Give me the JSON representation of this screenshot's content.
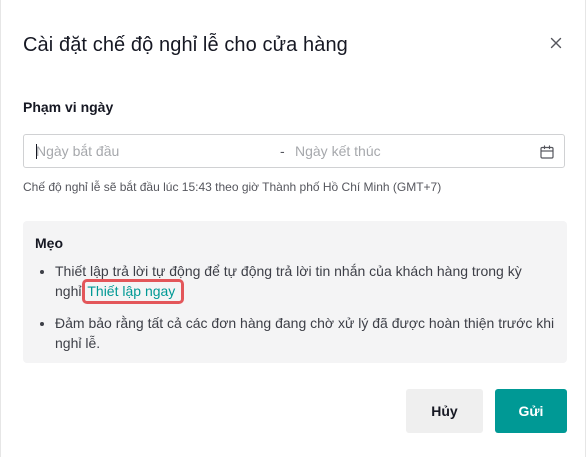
{
  "dialog": {
    "title": "Cài đặt chế độ nghỉ lễ cho cửa hàng",
    "close_icon": "close-icon"
  },
  "date_range": {
    "label": "Phạm vi ngày",
    "start_placeholder": "Ngày bắt đầu",
    "separator": "-",
    "end_placeholder": "Ngày kết thúc",
    "calendar_icon": "calendar-icon",
    "hint": "Chế độ nghỉ lễ sẽ bắt đầu lúc 15:43 theo giờ Thành phố Hồ Chí Minh (GMT+7)"
  },
  "tips": {
    "title": "Mẹo",
    "item1_text": "Thiết lập trả lời tự động để tự động trả lời tin nhắn của khách hàng trong kỳ nghỉ.",
    "item1_link": "Thiết lập ngay",
    "item2_text": "Đảm bảo rằng tất cả các đơn hàng đang chờ xử lý đã được hoàn thiện trước khi nghỉ lễ."
  },
  "buttons": {
    "cancel": "Hủy",
    "submit": "Gửi"
  },
  "colors": {
    "accent": "#009995",
    "highlight": "#e3565a",
    "tip_background": "#f4f4f5"
  }
}
